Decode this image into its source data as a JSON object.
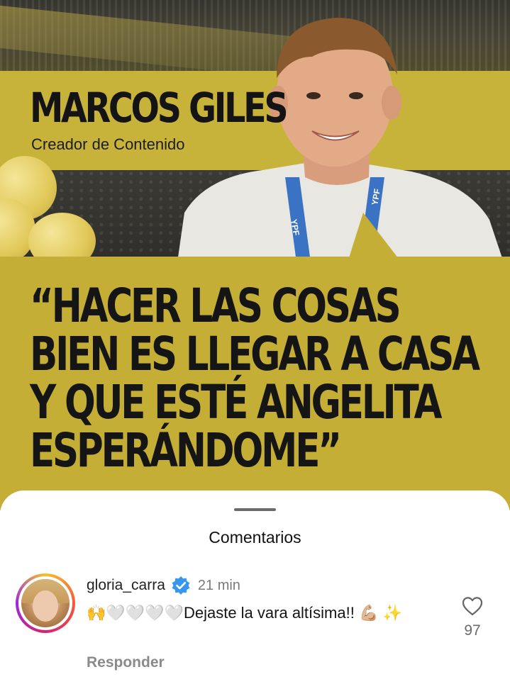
{
  "post": {
    "headline_name": "MARCOS GILES",
    "headline_role": "Creador de Contenido",
    "quote_lines": [
      "“HACER LAS COSAS",
      "BIEN ES LLEGAR A CASA",
      "Y QUE ESTÉ ANGELITA",
      "ESPERÁNDOME”"
    ],
    "lanyard_text": "YPF",
    "colors": {
      "band_yellow": "#c8b33a",
      "text_dark": "#141414"
    }
  },
  "comments_sheet": {
    "title": "Comentarios",
    "comments": [
      {
        "username": "gloria_carra",
        "verified": true,
        "time": "21 min",
        "text": "🙌🤍🤍🤍🤍Dejaste la vara altísima!! 💪🏼 ✨",
        "reply_label": "Responder",
        "likes": "97",
        "like_icon": "heart-outline-icon",
        "avatar_icon": "story-ring-avatar"
      }
    ]
  }
}
